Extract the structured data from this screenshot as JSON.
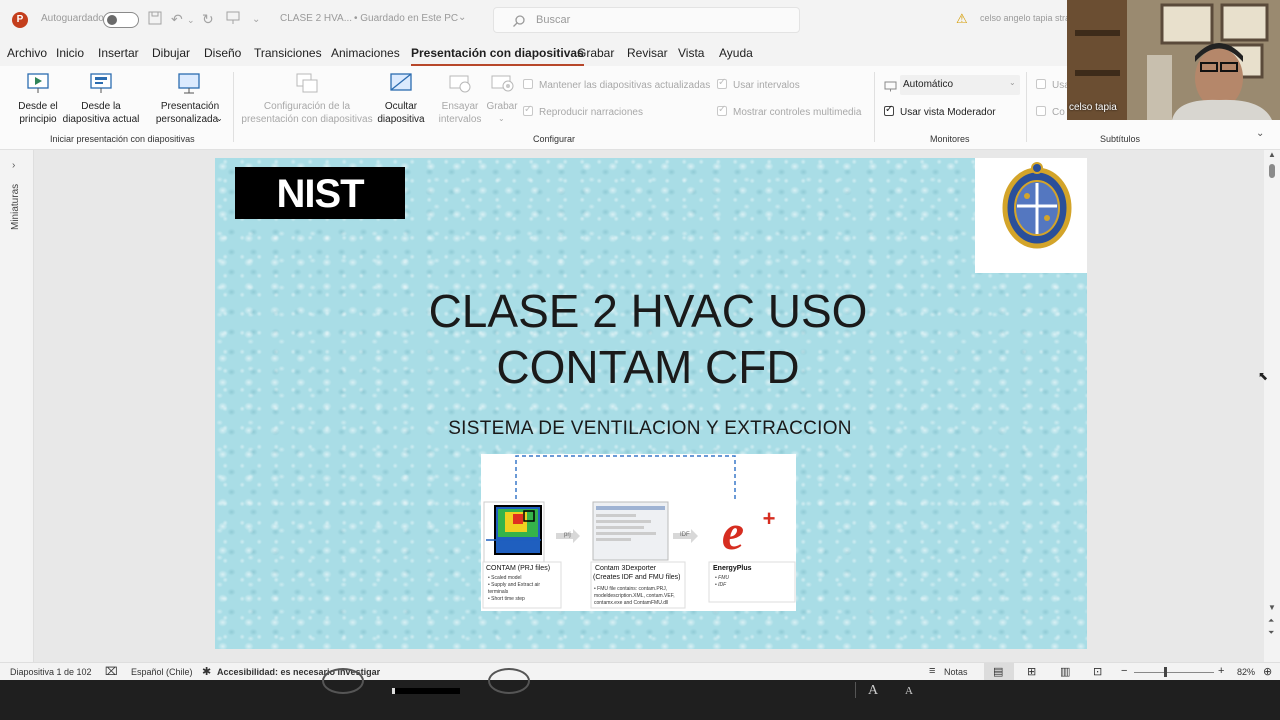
{
  "titlebar": {
    "autosave_label": "Autoguardado",
    "doc_title": "CLASE 2 HVA...",
    "save_status": "• Guardado en Este PC",
    "search_placeholder": "Buscar",
    "user_name": "celso angelo tapia stra"
  },
  "tabs": [
    {
      "label": "Archivo"
    },
    {
      "label": "Inicio"
    },
    {
      "label": "Insertar"
    },
    {
      "label": "Dibujar"
    },
    {
      "label": "Diseño"
    },
    {
      "label": "Transiciones"
    },
    {
      "label": "Animaciones"
    },
    {
      "label": "Presentación con diapositivas",
      "active": true
    },
    {
      "label": "Grabar"
    },
    {
      "label": "Revisar"
    },
    {
      "label": "Vista"
    },
    {
      "label": "Ayuda"
    }
  ],
  "ribbon": {
    "start": {
      "from_beginning_1": "Desde el",
      "from_beginning_2": "principio",
      "from_current_1": "Desde la",
      "from_current_2": "diapositiva actual",
      "custom_1": "Presentación",
      "custom_2": "personalizada",
      "group_label": "Iniciar presentación con diapositivas"
    },
    "configure": {
      "setup_1": "Configuración de la",
      "setup_2": "presentación con diapositivas",
      "hide_1": "Ocultar",
      "hide_2": "diapositiva",
      "rehearse_1": "Ensayar",
      "rehearse_2": "intervalos",
      "record": "Grabar",
      "keep_updated": "Mantener las diapositivas actualizadas",
      "play_narrations": "Reproducir narraciones",
      "use_timings": "Usar intervalos",
      "show_media_controls": "Mostrar controles multimedia",
      "group_label": "Configurar"
    },
    "monitors": {
      "monitor_value": "Automático",
      "presenter_view": "Usar vista Moderador",
      "group_label": "Monitores"
    },
    "subtitles": {
      "use_label": "Usa",
      "config_label": "Co",
      "group_label": "Subtítulos"
    }
  },
  "thumbnails_label": "Miniaturas",
  "slide": {
    "logo_text": "NIST",
    "title_line1": "CLASE 2 HVAC USO",
    "title_line2": "CONTAM CFD",
    "subtitle": "SISTEMA DE VENTILACION Y EXTRACCION",
    "diagram": {
      "contam_label": "CONTAM (PRJ files)",
      "contam_bullets": [
        "• Scaled model",
        "• Supply and Extract air",
        "  terminals",
        "• Short time step"
      ],
      "exporter_label_1": "Contam 3Dexporter",
      "exporter_label_2": "(Creates IDF and FMU files)",
      "exporter_bullets": [
        "• FMU file contains: contam.PRJ,",
        "  modeldescription.XML, contam.VEF,",
        "  contamx.exe and ContamFMU.dll"
      ],
      "energyplus_label": "EnergyPlus",
      "energyplus_bullets": [
        "• FMU",
        "• IDF"
      ],
      "arrow1_label": "prj",
      "arrow2_label": "IDF"
    }
  },
  "statusbar": {
    "slide_counter": "Diapositiva 1 de 102",
    "language": "Español (Chile)",
    "accessibility": "Accesibilidad: es necesario investigar",
    "notes": "Notas",
    "zoom": "82%"
  },
  "webcam": {
    "participant_name": "celso tapia"
  },
  "colors": {
    "accent": "#b7472a",
    "slide_bg": "#a9dde6",
    "status_bar": "#f3f3f3"
  }
}
